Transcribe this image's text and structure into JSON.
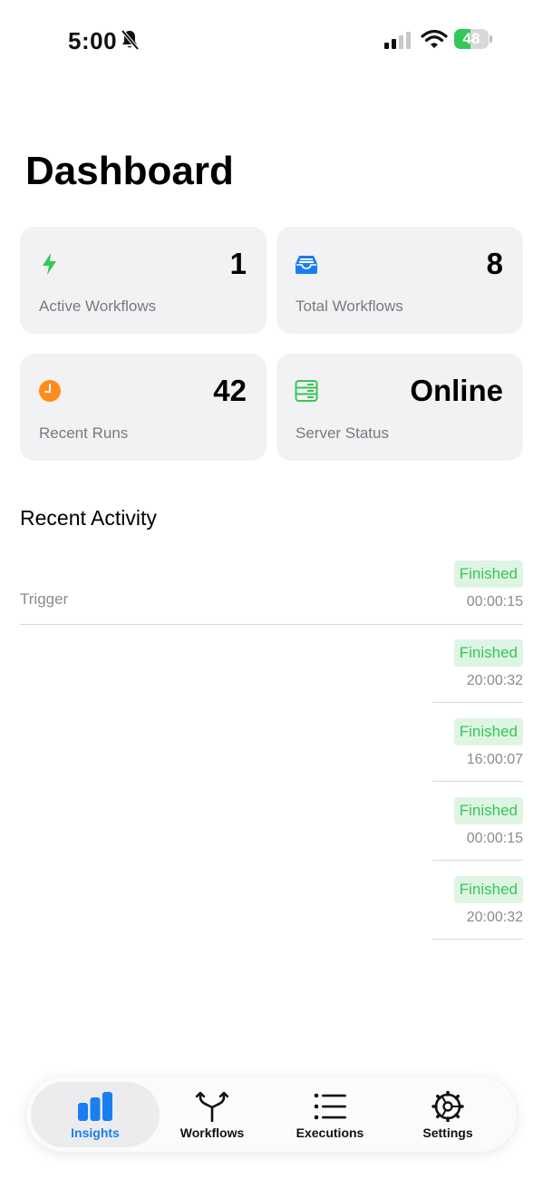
{
  "status_bar": {
    "time": "5:00",
    "battery": "48",
    "battery_level": 0.48
  },
  "page": {
    "title": "Dashboard"
  },
  "cards": [
    {
      "icon": "bolt-icon",
      "value": "1",
      "label": "Active Workflows",
      "color": "#34c759"
    },
    {
      "icon": "tray-icon",
      "value": "8",
      "label": "Total Workflows",
      "color": "#1a7ef0"
    },
    {
      "icon": "clock-icon",
      "value": "42",
      "label": "Recent Runs",
      "color": "#ff8c1a"
    },
    {
      "icon": "server-icon",
      "value": "Online",
      "label": "Server Status",
      "color": "#34c759"
    }
  ],
  "recent_activity": {
    "title": "Recent Activity",
    "items": [
      {
        "title": "Trigger",
        "status": "Finished",
        "time": "00:00:15"
      },
      {
        "title": "",
        "status": "Finished",
        "time": "20:00:32"
      },
      {
        "title": "",
        "status": "Finished",
        "time": "16:00:07"
      },
      {
        "title": "",
        "status": "Finished",
        "time": "00:00:15"
      },
      {
        "title": "",
        "status": "Finished",
        "time": "20:00:32"
      }
    ]
  },
  "tabs": [
    {
      "label": "Insights",
      "icon": "chart-bars-icon",
      "active": true
    },
    {
      "label": "Workflows",
      "icon": "branch-icon",
      "active": false
    },
    {
      "label": "Executions",
      "icon": "list-icon",
      "active": false
    },
    {
      "label": "Settings",
      "icon": "gear-icon",
      "active": false
    }
  ],
  "colors": {
    "accent": "#1a7ef0",
    "success": "#34c759",
    "success_bg": "#dff5e3",
    "card_bg": "#f2f2f4"
  }
}
